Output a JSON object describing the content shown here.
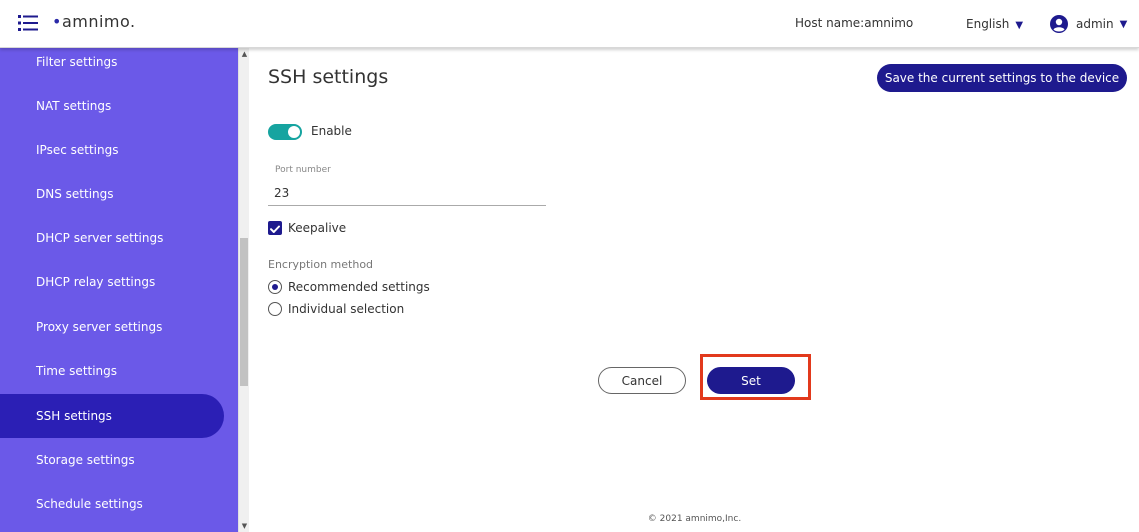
{
  "header": {
    "logo_text": "amnimo.",
    "host_label": "Host name:amnimo",
    "language": "English",
    "user": "admin"
  },
  "sidebar": {
    "items": [
      {
        "label": "Filter settings"
      },
      {
        "label": "NAT settings"
      },
      {
        "label": "IPsec settings"
      },
      {
        "label": "DNS settings"
      },
      {
        "label": "DHCP server settings"
      },
      {
        "label": "DHCP relay settings"
      },
      {
        "label": "Proxy server settings"
      },
      {
        "label": "Time settings"
      },
      {
        "label": "SSH settings",
        "active": true
      },
      {
        "label": "Storage settings"
      },
      {
        "label": "Schedule settings"
      }
    ]
  },
  "main": {
    "title": "SSH settings",
    "save_button": "Save the current settings to the device",
    "enable_label": "Enable",
    "enable_on": true,
    "port_label": "Port number",
    "port_value": "23",
    "keepalive_label": "Keepalive",
    "keepalive_checked": true,
    "encryption_label": "Encryption method",
    "encryption_options": [
      {
        "label": "Recommended settings",
        "selected": true
      },
      {
        "label": "Individual selection",
        "selected": false
      }
    ],
    "cancel_button": "Cancel",
    "set_button": "Set"
  },
  "footer": {
    "copyright": "© 2021 amnimo,Inc."
  },
  "colors": {
    "sidebar_bg": "#6b59e8",
    "sidebar_active": "#2b1fb5",
    "primary": "#1e1a8e",
    "toggle_on": "#16a4a0",
    "highlight": "#e2391c"
  },
  "icons": {
    "menu": "list-menu-icon",
    "user": "user-circle-icon",
    "caret": "caret-down-icon"
  }
}
